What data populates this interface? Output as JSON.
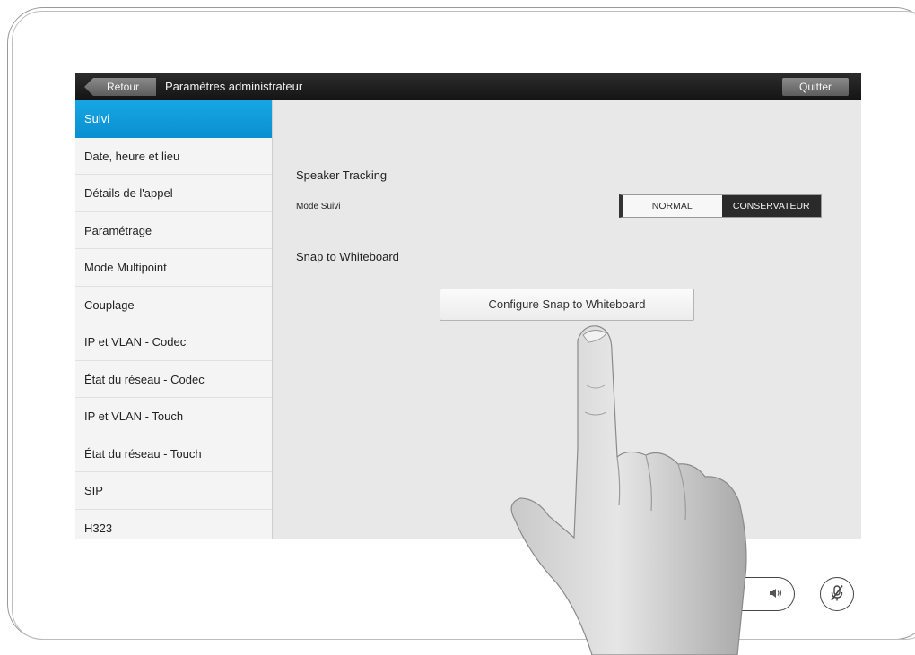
{
  "topbar": {
    "back_label": "Retour",
    "title": "Paramètres administrateur",
    "quit_label": "Quitter"
  },
  "sidebar": {
    "items": [
      {
        "label": "Suivi",
        "active": true
      },
      {
        "label": "Date, heure et lieu"
      },
      {
        "label": "Détails de l'appel"
      },
      {
        "label": "Paramétrage"
      },
      {
        "label": "Mode Multipoint"
      },
      {
        "label": "Couplage"
      },
      {
        "label": "IP et VLAN - Codec"
      },
      {
        "label": "État du réseau - Codec"
      },
      {
        "label": "IP et VLAN - Touch"
      },
      {
        "label": "État du réseau - Touch"
      },
      {
        "label": "SIP"
      },
      {
        "label": "H323"
      }
    ]
  },
  "main": {
    "speaker_tracking_heading": "Speaker Tracking",
    "mode_label": "Mode Suivi",
    "mode_options": [
      "NORMAL",
      "CONSERVATEUR"
    ],
    "mode_selected": "CONSERVATEUR",
    "snap_heading": "Snap to Whiteboard",
    "configure_button_label": "Configure Snap to Whiteboard"
  },
  "controls": {
    "volume_icon": "speaker-icon",
    "mute_icon": "mic-muted-icon"
  },
  "colors": {
    "accent": "#0a96d8",
    "topbar": "#1c1c1c",
    "selected_segment": "#2a2a2a"
  }
}
